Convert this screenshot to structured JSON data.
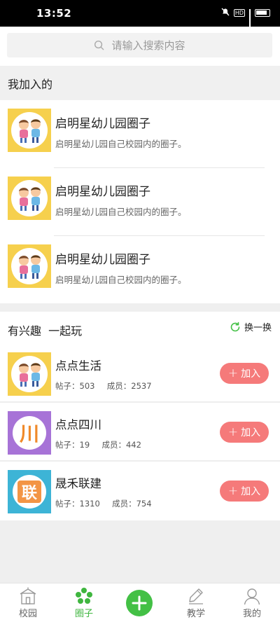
{
  "status_bar": {
    "time": "13:52",
    "icons": [
      "mute-icon",
      "hd-icon",
      "signal-icon",
      "battery-icon"
    ],
    "hd_label": "HD"
  },
  "search": {
    "placeholder": "请输入搜索内容",
    "icon": "search-icon"
  },
  "joined_section": {
    "title": "我加入的",
    "items": [
      {
        "title": "启明星幼儿园圈子",
        "desc": "启明星幼儿园自己校园内的圈子。",
        "avatar": "kids-avatar"
      },
      {
        "title": "启明星幼儿园圈子",
        "desc": "启明星幼儿园自己校园内的圈子。",
        "avatar": "kids-avatar"
      },
      {
        "title": "启明星幼儿园圈子",
        "desc": "启明星幼儿园自己校园内的圈子。",
        "avatar": "kids-avatar"
      }
    ]
  },
  "interest_section": {
    "title": "有兴趣  一起玩",
    "refresh_label": "换一换",
    "join_label": "加入",
    "posts_prefix": "帖子：",
    "members_prefix": "成员：",
    "items": [
      {
        "name": "点点生活",
        "posts": "503",
        "members": "2537",
        "avatar": "kids-avatar"
      },
      {
        "name": "点点四川",
        "posts": "19",
        "members": "442",
        "avatar": "chuan-avatar",
        "avatar_text": "川"
      },
      {
        "name": "晟禾联建",
        "posts": "1310",
        "members": "754",
        "avatar": "lian-avatar",
        "avatar_text": "联"
      }
    ]
  },
  "colors": {
    "accent_green": "#43c045",
    "join_button": "#f57a7a",
    "avatar_yellow": "#f6d04d",
    "avatar_purple": "#a773d7",
    "avatar_teal": "#3db4d6"
  },
  "tabbar": {
    "tabs": [
      {
        "label": "校园",
        "icon": "school-icon",
        "active": false
      },
      {
        "label": "圈子",
        "icon": "circle-icon",
        "active": true
      },
      {
        "label": "",
        "icon": "add-icon",
        "active": false
      },
      {
        "label": "教学",
        "icon": "pen-icon",
        "active": false
      },
      {
        "label": "我的",
        "icon": "profile-icon",
        "active": false
      }
    ]
  }
}
